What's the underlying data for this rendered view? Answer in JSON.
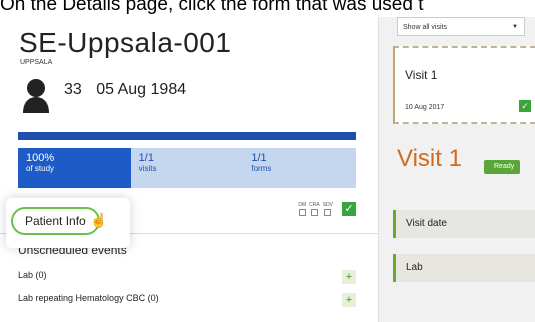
{
  "caption": "On the Details page, click the form that was used t",
  "subject": {
    "id": "SE-Uppsala-001",
    "site": "UPPSALA",
    "age": "33",
    "dob": "05 Aug 1984"
  },
  "stats": [
    {
      "value": "100%",
      "label": "of study"
    },
    {
      "value": "1/1",
      "label": "visits"
    },
    {
      "value": "1/1",
      "label": "forms"
    }
  ],
  "form_tab": {
    "label": "Patient Info",
    "roles": [
      "DM",
      "CRA",
      "SDV"
    ]
  },
  "unscheduled": {
    "heading": "Unscheduled events",
    "events": [
      "Lab (0)",
      "Lab repeating Hematology CBC (0)"
    ]
  },
  "right_panel": {
    "filter": "Show all visits",
    "visit_card": {
      "title": "Visit 1",
      "date": "10 Aug 2017"
    },
    "visit_title": "Visit 1",
    "status": "Ready",
    "sections": [
      "Visit date",
      "Lab"
    ]
  },
  "colors": {
    "progress": "#1e4fae",
    "accent_green": "#5aa63a",
    "visit_orange": "#d2691e"
  }
}
